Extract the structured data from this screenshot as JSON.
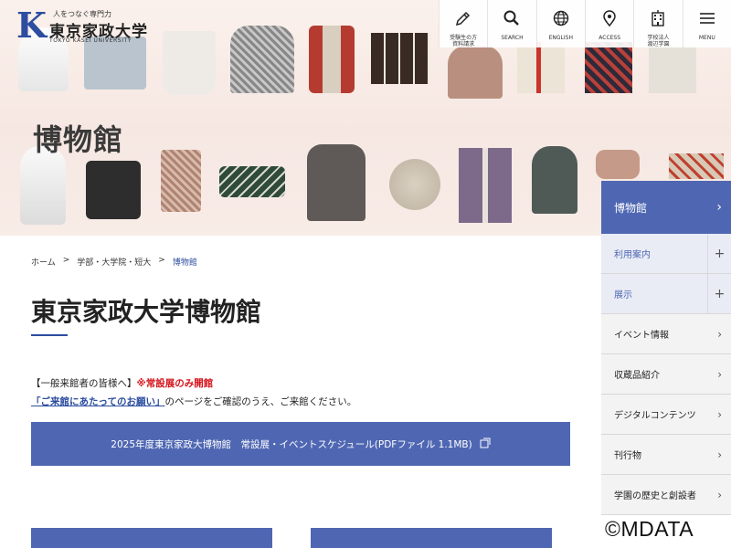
{
  "hero": {
    "title": "博物館"
  },
  "logo": {
    "mark": "K",
    "tagline": "人をつなぐ専門力",
    "name": "東京家政大学",
    "name_en": "TOKYO KASEI UNIVERSITY"
  },
  "topnav": [
    {
      "label": "受験生の方\n資料請求",
      "icon": "pencil-icon"
    },
    {
      "label": "SEARCH",
      "icon": "search-icon"
    },
    {
      "label": "ENGLISH",
      "icon": "globe-icon"
    },
    {
      "label": "ACCESS",
      "icon": "map-pin-icon"
    },
    {
      "label": "学校法人\n渡辺学園",
      "icon": "building-icon"
    },
    {
      "label": "MENU",
      "icon": "hamburger-icon"
    }
  ],
  "breadcrumb": {
    "home": "ホーム",
    "sep": ">",
    "level1": "学部・大学院・短大",
    "current": "博物館"
  },
  "main": {
    "title": "東京家政大学博物館",
    "notice_prefix": "【一般来館者の皆様へ】",
    "notice_highlight": "※常設展のみ開館",
    "notice_link": "「ご来館にあたってのお願い」",
    "notice_suffix": "のページをご確認のうえ、ご来館ください。",
    "pdf_button": "2025年度東京家政大博物館　常設展・イベントスケジュール(PDFファイル 1.1MB)"
  },
  "side_nav": {
    "header": "博物館",
    "items": [
      {
        "label": "利用案内",
        "expandable": true
      },
      {
        "label": "展示",
        "expandable": true
      },
      {
        "label": "イベント情報",
        "expandable": false
      },
      {
        "label": "収蔵品紹介",
        "expandable": false
      },
      {
        "label": "デジタルコンテンツ",
        "expandable": false
      },
      {
        "label": "刊行物",
        "expandable": false
      },
      {
        "label": "学園の歴史と創設者",
        "expandable": false
      }
    ]
  },
  "watermark": "©MDATA",
  "colors": {
    "accent": "#4f67b3",
    "brand": "#2c4da0",
    "alert": "#d4141c"
  }
}
